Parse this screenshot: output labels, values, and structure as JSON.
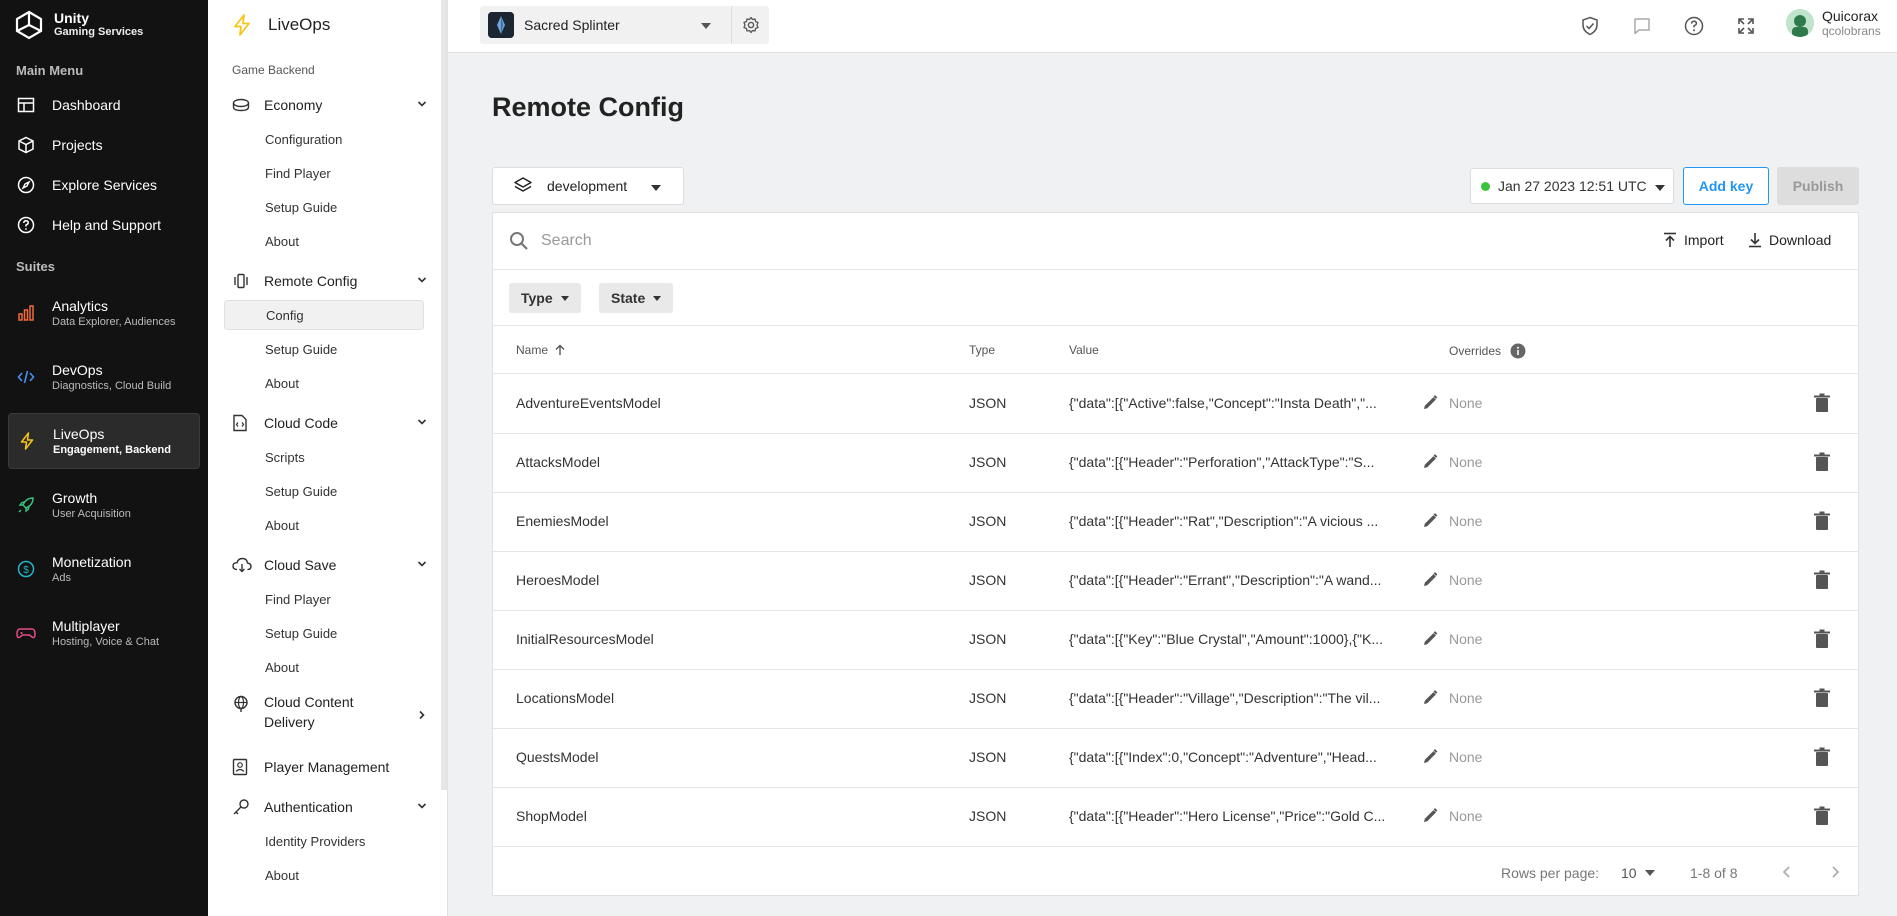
{
  "brand": {
    "line1": "Unity",
    "line2": "Gaming Services"
  },
  "main_nav": {
    "section_main": "Main Menu",
    "items": [
      {
        "label": "Dashboard",
        "icon": "dashboard-icon"
      },
      {
        "label": "Projects",
        "icon": "cube-icon"
      },
      {
        "label": "Explore Services",
        "icon": "compass-icon"
      },
      {
        "label": "Help and Support",
        "icon": "help-icon"
      }
    ],
    "section_suites": "Suites",
    "suites": [
      {
        "title": "Analytics",
        "subtitle": "Data Explorer, Audiences",
        "icon": "analytics-icon",
        "color": "#f26b3a"
      },
      {
        "title": "DevOps",
        "subtitle": "Diagnostics, Cloud Build",
        "icon": "code-icon",
        "color": "#4a8df0"
      },
      {
        "title": "LiveOps",
        "subtitle": "Engagement, Backend",
        "icon": "bolt-icon",
        "color": "#f5c518"
      },
      {
        "title": "Growth",
        "subtitle": "User Acquisition",
        "icon": "rocket-icon",
        "color": "#3cc17b"
      },
      {
        "title": "Monetization",
        "subtitle": "Ads",
        "icon": "coin-icon",
        "color": "#22b6c9"
      },
      {
        "title": "Multiplayer",
        "subtitle": "Hosting, Voice & Chat",
        "icon": "gamepad-icon",
        "color": "#e84a8a"
      }
    ]
  },
  "sub_nav": {
    "title": "LiveOps",
    "section": "Game Backend",
    "economy": {
      "label": "Economy",
      "links": [
        "Configuration",
        "Find Player",
        "Setup Guide",
        "About"
      ]
    },
    "remote_config": {
      "label": "Remote Config",
      "links": [
        "Config",
        "Setup Guide",
        "About"
      ]
    },
    "cloud_code": {
      "label": "Cloud Code",
      "links": [
        "Scripts",
        "Setup Guide",
        "About"
      ]
    },
    "cloud_save": {
      "label": "Cloud Save",
      "links": [
        "Find Player",
        "Setup Guide",
        "About"
      ]
    },
    "ccd": {
      "line1": "Cloud Content",
      "line2": "Delivery"
    },
    "player_management": "Player Management",
    "authentication": {
      "label": "Authentication",
      "links": [
        "Identity Providers",
        "About"
      ]
    }
  },
  "topbar": {
    "project": "Sacred Splinter",
    "user_name": "Quicorax",
    "user_handle": "qcolobrans"
  },
  "page": {
    "title": "Remote Config",
    "environment": "development",
    "version": "Jan 27 2023 12:51 UTC",
    "add_key": "Add key",
    "publish": "Publish",
    "search_placeholder": "Search",
    "import": "Import",
    "download": "Download",
    "filter_type": "Type",
    "filter_state": "State"
  },
  "table": {
    "headers": {
      "name": "Name",
      "type": "Type",
      "value": "Value",
      "overrides": "Overrides"
    },
    "rows": [
      {
        "name": "AdventureEventsModel",
        "type": "JSON",
        "value": "{\"data\":[{\"Active\":false,\"Concept\":\"Insta Death\",\"...",
        "overrides": "None"
      },
      {
        "name": "AttacksModel",
        "type": "JSON",
        "value": "{\"data\":[{\"Header\":\"Perforation\",\"AttackType\":\"S...",
        "overrides": "None"
      },
      {
        "name": "EnemiesModel",
        "type": "JSON",
        "value": "{\"data\":[{\"Header\":\"Rat\",\"Description\":\"A vicious ...",
        "overrides": "None"
      },
      {
        "name": "HeroesModel",
        "type": "JSON",
        "value": "{\"data\":[{\"Header\":\"Errant\",\"Description\":\"A wand...",
        "overrides": "None"
      },
      {
        "name": "InitialResourcesModel",
        "type": "JSON",
        "value": "{\"data\":[{\"Key\":\"Blue Crystal\",\"Amount\":1000},{\"K...",
        "overrides": "None"
      },
      {
        "name": "LocationsModel",
        "type": "JSON",
        "value": "{\"data\":[{\"Header\":\"Village\",\"Description\":\"The vil...",
        "overrides": "None"
      },
      {
        "name": "QuestsModel",
        "type": "JSON",
        "value": "{\"data\":[{\"Index\":0,\"Concept\":\"Adventure\",\"Head...",
        "overrides": "None"
      },
      {
        "name": "ShopModel",
        "type": "JSON",
        "value": "{\"data\":[{\"Header\":\"Hero License\",\"Price\":\"Gold C...",
        "overrides": "None"
      }
    ]
  },
  "pagination": {
    "rows_label": "Rows per page:",
    "rows_value": "10",
    "range": "1-8 of 8"
  }
}
